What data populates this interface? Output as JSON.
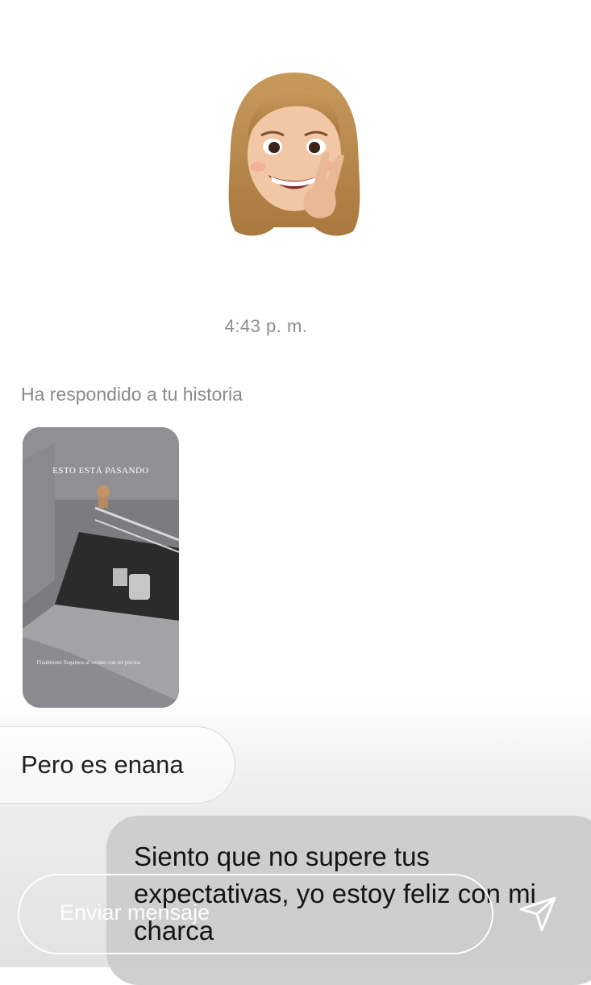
{
  "conversation": {
    "timestamp": "4:43 p. m.",
    "story_reply_note": "Ha respondido a tu historia",
    "story_preview": {
      "overlay_title": "ESTO ESTÁ PASANDO",
      "overlay_caption": "Finalmente llegamos al verano con mi piscina"
    },
    "messages": [
      {
        "direction": "received",
        "text": "Pero es enana"
      },
      {
        "direction": "sent",
        "text": "Siento que no supere tus expectativas, yo estoy feliz con mi charca"
      }
    ]
  },
  "composer": {
    "placeholder": "Enviar mensaje"
  },
  "icons": {
    "memoji": "memoji-sticker",
    "send": "send-arrow-icon"
  },
  "colors": {
    "timestamp": "#8e8e8e",
    "sent_bubble": "#cbcbcb"
  }
}
